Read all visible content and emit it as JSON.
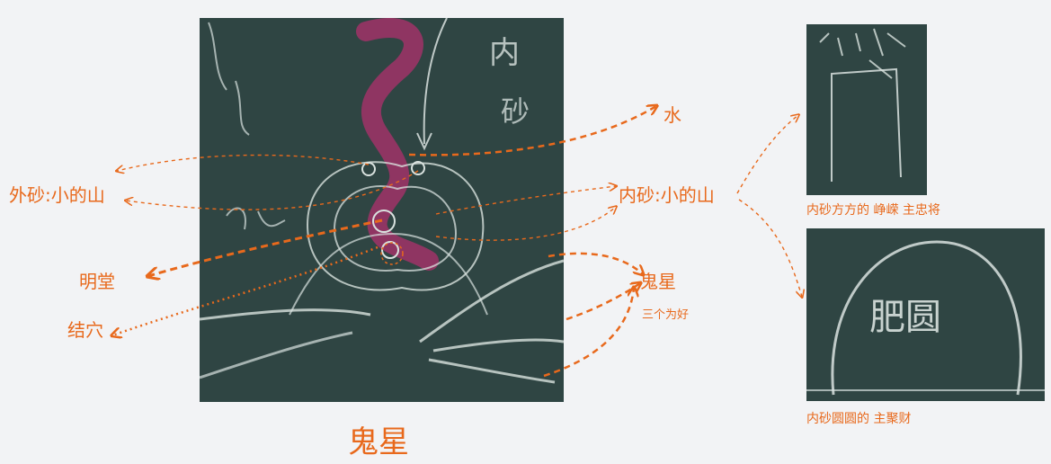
{
  "main_photo": {
    "chalk_glyphs": [
      "内",
      "砂"
    ]
  },
  "labels": {
    "water": "水",
    "outer_sand": "外砂:小的山",
    "inner_sand": "内砂:小的山",
    "bright_hall": "明堂",
    "acupoint": "结穴",
    "ghost_star": "鬼星",
    "ghost_star_note": "三个为好"
  },
  "bottom_title": "鬼星",
  "right_panels": {
    "top_caption": "内砂方方的 峥嵘 主忠将",
    "bottom_caption": "内砂圆圆的 主聚财",
    "bottom_chalk_text": "肥圆"
  },
  "colors": {
    "accent": "#e8691c",
    "board": "#2f4543",
    "chalk": "#d9e2df",
    "magenta_chalk": "#b0306c"
  }
}
